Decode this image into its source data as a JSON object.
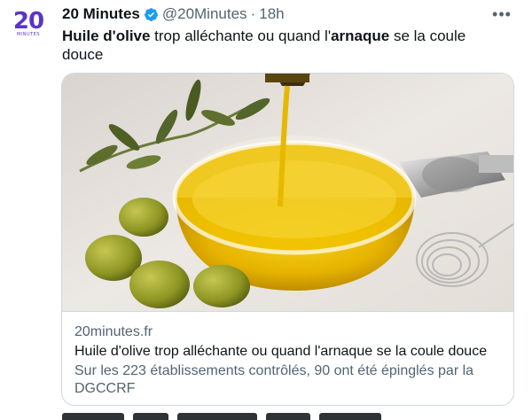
{
  "tweet": {
    "avatar": {
      "logo_number": "20",
      "logo_sub": "MINUTES",
      "icon": "twenty-minutes-logo-icon"
    },
    "author": {
      "name": "20 Minutes",
      "verified_icon": "verified-badge-icon",
      "handle": "@20Minutes",
      "separator": "·",
      "time": "18h"
    },
    "more_label": "•••",
    "text_parts": {
      "p1": "Huile d'olive",
      "p2": " trop alléchante ou quand l'",
      "p3": "arnaque",
      "p4": " se la coule douce"
    },
    "card": {
      "image_alt": "olive oil pouring into glass bowl",
      "domain": "20minutes.fr",
      "title": "Huile d'olive trop alléchante ou quand l'arnaque se la coule douce",
      "description": "Sur les 223 établissements contrôlés, 90 ont été épinglés par la DGCCRF"
    }
  },
  "colors": {
    "text": "#0f1419",
    "secondary": "#536471",
    "border": "#cfd9de",
    "verified": "#1d9bf0",
    "brand": "#5a34c8"
  }
}
